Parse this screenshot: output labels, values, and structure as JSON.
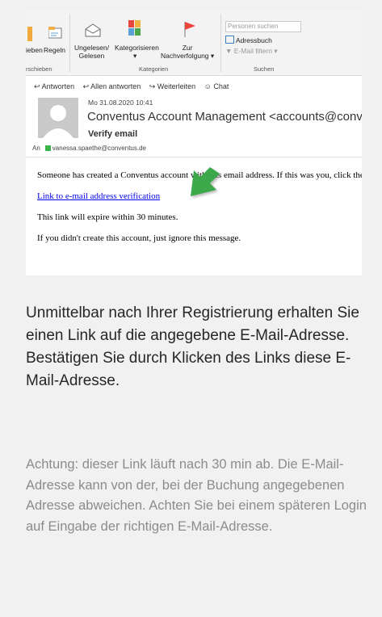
{
  "ribbon": {
    "verschieben_label": "ieben",
    "regeln_label": "Regeln",
    "ungelesen_label": "Ungelesen/\nGelesen",
    "kategorisieren_label": "Kategorisieren",
    "nachverfolgung_label": "Zur\nNachverfolgung",
    "group_verschieben": "rschieben",
    "group_kategorien": "Kategorien",
    "group_suchen": "Suchen",
    "search_placeholder": "Personen suchen",
    "adressbuch_label": "Adressbuch",
    "email_filtern_label": "E-Mail filtern"
  },
  "actions": {
    "reply": "Antworten",
    "reply_all": "Allen antworten",
    "forward": "Weiterleiten",
    "chat": "Chat"
  },
  "message": {
    "date": "Mo 31.08.2020 10:41",
    "sender": "Conventus Account Management <accounts@conventus.de>",
    "subject": "Verify email",
    "to_label": "An",
    "to_address": "vanessa.spaethe@conventus.de"
  },
  "email_body": {
    "line1": "Someone has created a Conventus account with this email address. If this was you, click the link below to verify your email address",
    "link": "Link to e-mail address verification",
    "line2": "This link will expire within 30 minutes.",
    "line3": "If you didn't create this account, just ignore this message."
  },
  "content": {
    "main_text": "Unmittelbar nach Ihrer Registrierung erhalten Sie einen Link auf die angegebene E-Mail-Adresse. Bestätigen Sie durch Klicken des Links diese E-Mail-Adresse.",
    "note_text": "Achtung: dieser Link läuft nach 30 min ab. Die E-Mail-Adresse kann von der, bei der Buchung angegebenen Adresse abweichen. Achten Sie bei einem späteren Login auf Eingabe der richtigen E-Mail-Adresse."
  },
  "colors": {
    "arrow_green": "#3aa84a",
    "link_blue": "#0000ee",
    "flag_red": "#e8453c"
  }
}
